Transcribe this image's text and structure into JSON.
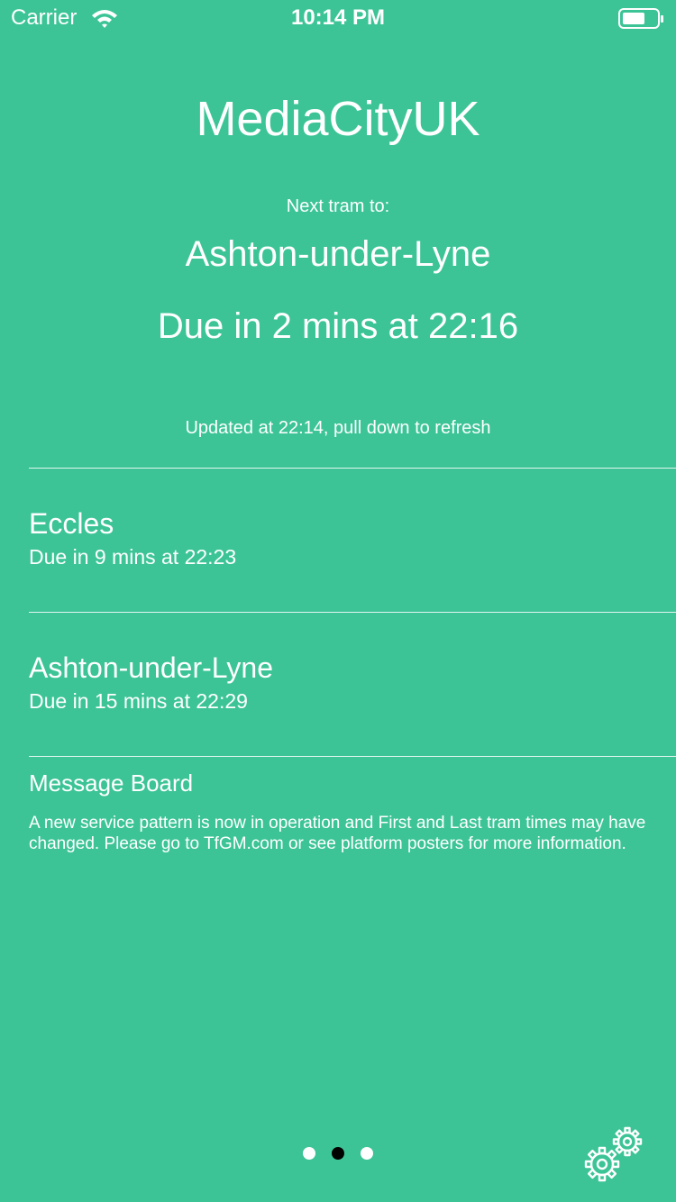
{
  "status_bar": {
    "carrier": "Carrier",
    "time": "10:14 PM",
    "icons": [
      "wifi-icon",
      "battery-icon"
    ]
  },
  "station": {
    "name": "MediaCityUK"
  },
  "next_tram": {
    "label": "Next tram to:",
    "destination": "Ashton-under-Lyne",
    "due": "Due in 2 mins at 22:16"
  },
  "updated_text": "Updated at 22:14, pull down to refresh",
  "departures": [
    {
      "destination": "Eccles",
      "due": "Due in 9 mins at 22:23"
    },
    {
      "destination": "Ashton-under-Lyne",
      "due": "Due in 15 mins at 22:29"
    }
  ],
  "message_board": {
    "title": "Message Board",
    "body": "A new service pattern is now in operation and First and Last tram times may have changed. Please go to TfGM.com or see platform posters for more information."
  },
  "pager": {
    "pages": 3,
    "current": 2
  },
  "settings_icon": "gears-icon",
  "colors": {
    "background": "#3cc497",
    "text": "#ffffff",
    "active_dot": "#000000"
  }
}
